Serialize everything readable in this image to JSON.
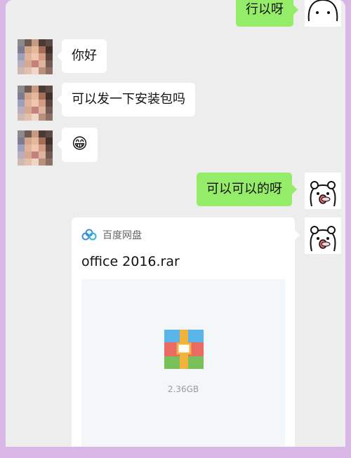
{
  "chat": {
    "top_message_partial": "行以呀",
    "messages": [
      {
        "side": "left",
        "text": "你好"
      },
      {
        "side": "left",
        "text": "可以发一下安装包吗"
      },
      {
        "side": "left",
        "emoji": "😁"
      },
      {
        "side": "right",
        "text": "可以可以的呀"
      }
    ],
    "file_card": {
      "source": "百度网盘",
      "file_name": "office 2016.rar",
      "file_size": "2.36GB",
      "icon": "archive-icon"
    }
  },
  "colors": {
    "outer_border": "#d8b6e6",
    "chat_background": "#ededed",
    "my_bubble": "#95ec69",
    "other_bubble": "#ffffff"
  }
}
